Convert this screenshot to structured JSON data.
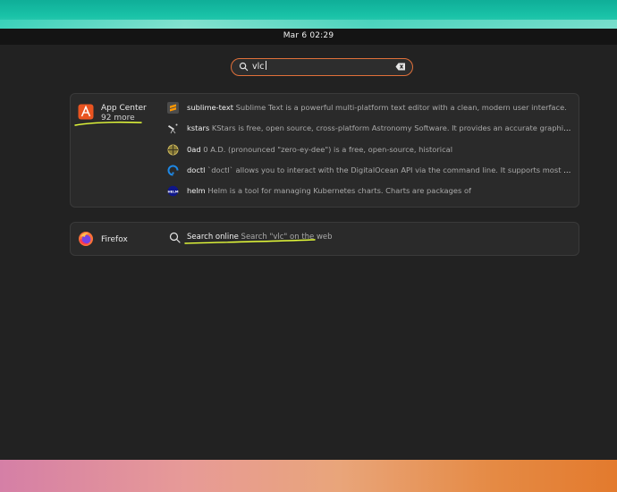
{
  "topbar": {
    "clock": "Mar 6  02:29"
  },
  "search": {
    "value": "vlc"
  },
  "providers": [
    {
      "name": "App Center",
      "more": "92 more",
      "results": [
        {
          "name": "sublime-text",
          "description": "Sublime Text is a powerful multi-platform text editor with a clean, modern user interface.",
          "icon": "sublime-icon"
        },
        {
          "name": "kstars",
          "description": "KStars is free, open source, cross-platform Astronomy Software. It provides an accurate graphical simulatio…",
          "icon": "telescope-icon"
        },
        {
          "name": "0ad",
          "description": "0 A.D. (pronounced \"zero-ey-dee\") is a free, open-source, historical",
          "icon": "0ad-icon"
        },
        {
          "name": "doctl",
          "description": "`doctl` allows you to interact with the DigitalOcean API via the command line. It supports most functionality…",
          "icon": "digitalocean-icon"
        },
        {
          "name": "helm",
          "description": "Helm is a tool for managing Kubernetes charts. Charts are packages of",
          "icon": "helm-icon"
        }
      ]
    },
    {
      "name": "Firefox",
      "results": [
        {
          "name": "Search online",
          "description": "Search \"vlc\" on the web",
          "icon": "search-icon"
        }
      ]
    }
  ],
  "colors": {
    "search_border": "#e0703a",
    "annotation": "#e8ff3a",
    "app_center": "#e95420"
  }
}
